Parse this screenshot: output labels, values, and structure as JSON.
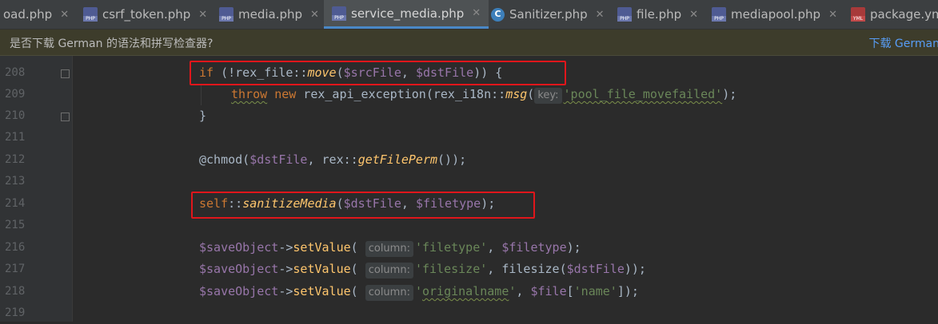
{
  "tabs": [
    {
      "label": "oad.php",
      "icon": "php-file-icon",
      "active": false
    },
    {
      "label": "csrf_token.php",
      "icon": "php-file-icon",
      "active": false
    },
    {
      "label": "media.php",
      "icon": "php-file-icon",
      "active": false
    },
    {
      "label": "service_media.php",
      "icon": "php-file-icon",
      "active": true
    },
    {
      "label": "Sanitizer.php",
      "icon": "php-class-icon",
      "active": false
    },
    {
      "label": "file.php",
      "icon": "php-file-icon",
      "active": false
    },
    {
      "label": "mediapool.php",
      "icon": "php-file-icon",
      "active": false
    },
    {
      "label": "package.yml",
      "icon": "yml-file-icon",
      "active": false
    }
  ],
  "notification": {
    "message": "是否下载 German 的语法和拼写检查器?",
    "action": "下载 German"
  },
  "code": {
    "line_numbers": [
      "208",
      "209",
      "210",
      "211",
      "212",
      "213",
      "214",
      "215",
      "216",
      "217",
      "218",
      "219"
    ],
    "hint_key": "key:",
    "hint_column": "column:",
    "l208": {
      "kw": "if",
      "p1": " (!rex_file::",
      "fn": "move",
      "p2": "(",
      "v1": "$srcFile",
      "p3": ", ",
      "v2": "$dstFile",
      "p4": ")) {"
    },
    "l209": {
      "kw1": "throw",
      "kw2": "new",
      "p1": " rex_api_exception(rex_i18n::",
      "fn": "msg",
      "p2": "(",
      "str": "'pool_file_movefailed'",
      "p3": ");"
    },
    "l210": "}",
    "l212": {
      "p1": "@chmod(",
      "v1": "$dstFile",
      "p2": ", rex::",
      "fn": "getFilePerm",
      "p3": "());"
    },
    "l214": {
      "kw": "self",
      "p1": "::",
      "fn": "sanitizeMedia",
      "p2": "(",
      "v1": "$dstFile",
      "p3": ", ",
      "v2": "$filetype",
      "p4": ");"
    },
    "l216": {
      "v1": "$saveObject",
      "p1": "->",
      "fn": "setValue",
      "p2": "( ",
      "str": "'filetype'",
      "p3": ", ",
      "v2": "$filetype",
      "p4": ");"
    },
    "l217": {
      "v1": "$saveObject",
      "p1": "->",
      "fn": "setValue",
      "p2": "( ",
      "str": "'filesize'",
      "p3": ", filesize(",
      "v2": "$dstFile",
      "p4": "));"
    },
    "l218": {
      "v1": "$saveObject",
      "p1": "->",
      "fn": "setValue",
      "p2": "( ",
      "str_q1": "'",
      "str": "originalname",
      "str_q2": "'",
      "p3": ", ",
      "v2": "$file",
      "p4": "[",
      "str2": "'name'",
      "p5": "]);"
    }
  },
  "colors": {
    "keyword": "#cc7832",
    "variable": "#9876aa",
    "function": "#ffc66d",
    "string": "#6a8759",
    "plain": "#a9b7c6",
    "highlight_box": "#e0161b"
  }
}
